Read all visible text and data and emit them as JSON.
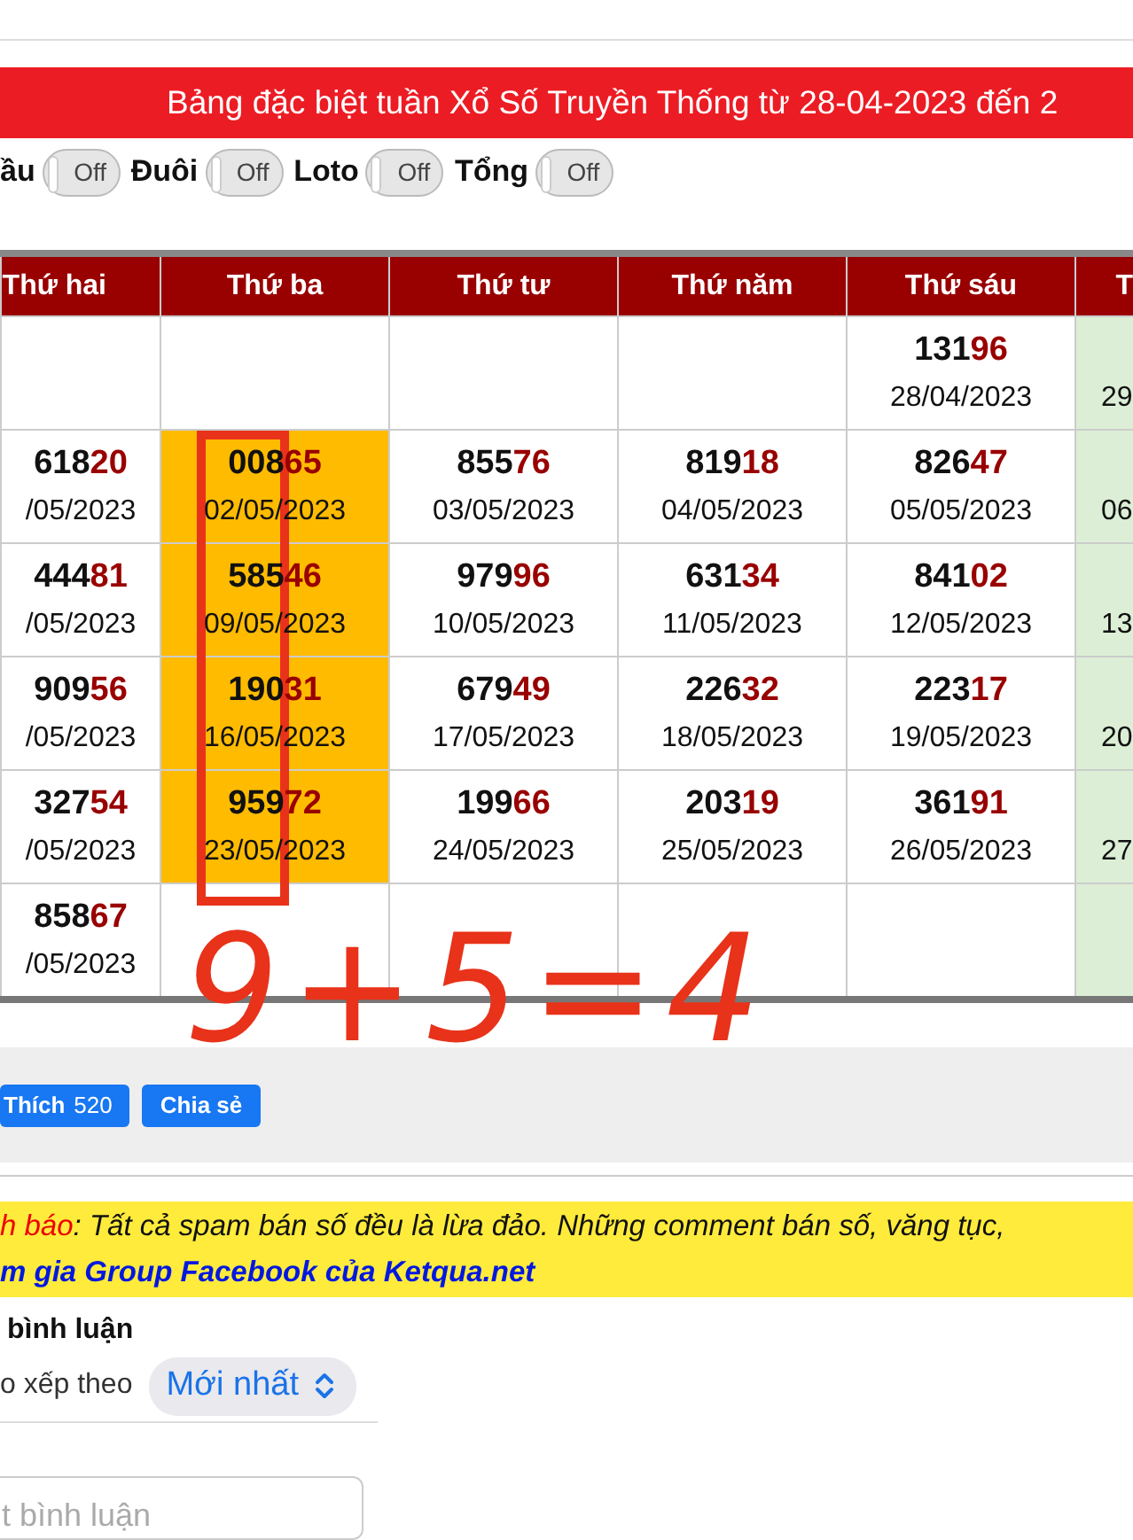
{
  "title": "Bảng đặc biệt tuần Xổ Số Truyền Thống từ 28-04-2023 đến 2",
  "toggles": [
    {
      "label": "ầu",
      "state_text": "Off",
      "on": false
    },
    {
      "label": "Đuôi",
      "state_text": "Off",
      "on": false
    },
    {
      "label": "Loto",
      "state_text": "Off",
      "on": false
    },
    {
      "label": "Tổng",
      "state_text": "Off",
      "on": false
    }
  ],
  "table": {
    "columns": [
      {
        "label": "Thứ hai",
        "kind": "partial_left",
        "shaded": false
      },
      {
        "label": "Thứ ba",
        "kind": "full",
        "shaded": false
      },
      {
        "label": "Thứ tư",
        "kind": "full",
        "shaded": false
      },
      {
        "label": "Thứ năm",
        "kind": "full",
        "shaded": false
      },
      {
        "label": "Thứ sáu",
        "kind": "full",
        "shaded": false
      },
      {
        "label": "T",
        "kind": "partial_right",
        "shaded": true
      }
    ],
    "rows": [
      {
        "cells": [
          {
            "kind": "empty"
          },
          {
            "kind": "empty"
          },
          {
            "kind": "empty"
          },
          {
            "kind": "empty"
          },
          {
            "kind": "result",
            "digits": "131",
            "last_two": "96",
            "date": "28/04/2023",
            "highlighted": false
          },
          {
            "kind": "partial",
            "text": "29"
          }
        ]
      },
      {
        "cells": [
          {
            "kind": "result",
            "digits": "618",
            "last_two": "20",
            "date": "/05/2023",
            "highlighted": false
          },
          {
            "kind": "result",
            "digits": "008",
            "last_two": "65",
            "date": "02/05/2023",
            "highlighted": true
          },
          {
            "kind": "result",
            "digits": "855",
            "last_two": "76",
            "date": "03/05/2023",
            "highlighted": false
          },
          {
            "kind": "result",
            "digits": "819",
            "last_two": "18",
            "date": "04/05/2023",
            "highlighted": false
          },
          {
            "kind": "result",
            "digits": "826",
            "last_two": "47",
            "date": "05/05/2023",
            "highlighted": false
          },
          {
            "kind": "partial",
            "text": "06"
          }
        ]
      },
      {
        "cells": [
          {
            "kind": "result",
            "digits": "444",
            "last_two": "81",
            "date": "/05/2023",
            "highlighted": false
          },
          {
            "kind": "result",
            "digits": "585",
            "last_two": "46",
            "date": "09/05/2023",
            "highlighted": true
          },
          {
            "kind": "result",
            "digits": "979",
            "last_two": "96",
            "date": "10/05/2023",
            "highlighted": false
          },
          {
            "kind": "result",
            "digits": "631",
            "last_two": "34",
            "date": "11/05/2023",
            "highlighted": false
          },
          {
            "kind": "result",
            "digits": "841",
            "last_two": "02",
            "date": "12/05/2023",
            "highlighted": false
          },
          {
            "kind": "partial",
            "text": "13"
          }
        ]
      },
      {
        "cells": [
          {
            "kind": "result",
            "digits": "909",
            "last_two": "56",
            "date": "/05/2023",
            "highlighted": false
          },
          {
            "kind": "result",
            "digits": "190",
            "last_two": "31",
            "date": "16/05/2023",
            "highlighted": true
          },
          {
            "kind": "result",
            "digits": "679",
            "last_two": "49",
            "date": "17/05/2023",
            "highlighted": false
          },
          {
            "kind": "result",
            "digits": "226",
            "last_two": "32",
            "date": "18/05/2023",
            "highlighted": false
          },
          {
            "kind": "result",
            "digits": "223",
            "last_two": "17",
            "date": "19/05/2023",
            "highlighted": false
          },
          {
            "kind": "partial",
            "text": "20"
          }
        ]
      },
      {
        "cells": [
          {
            "kind": "result",
            "digits": "327",
            "last_two": "54",
            "date": "/05/2023",
            "highlighted": false
          },
          {
            "kind": "result",
            "digits": "959",
            "last_two": "72",
            "date": "23/05/2023",
            "highlighted": true
          },
          {
            "kind": "result",
            "digits": "199",
            "last_two": "66",
            "date": "24/05/2023",
            "highlighted": false
          },
          {
            "kind": "result",
            "digits": "203",
            "last_two": "19",
            "date": "25/05/2023",
            "highlighted": false
          },
          {
            "kind": "result",
            "digits": "361",
            "last_two": "91",
            "date": "26/05/2023",
            "highlighted": false
          },
          {
            "kind": "partial",
            "text": "27"
          }
        ]
      },
      {
        "cells": [
          {
            "kind": "result",
            "digits": "858",
            "last_two": "67",
            "date": "/05/2023",
            "highlighted": false
          },
          {
            "kind": "empty"
          },
          {
            "kind": "empty"
          },
          {
            "kind": "empty"
          },
          {
            "kind": "empty"
          },
          {
            "kind": "empty"
          }
        ]
      }
    ]
  },
  "annotation": {
    "text": "9+5=4"
  },
  "social_buttons": [
    {
      "label": "Thích",
      "count": "520"
    },
    {
      "label": "Chia sẻ"
    }
  ],
  "notice": {
    "line_1": "h báo",
    "line_1_rest": ": Tất cả spam bán số đều là lừa đảo. Những comment bán số, văng tục,",
    "link": "m gia Group Facebook của Ketqua.net"
  },
  "comments": {
    "heading": "bình luận",
    "sort_label": "o xếp theo",
    "sort_value": "Mới nhất",
    "placeholder": "t bình luận"
  }
}
